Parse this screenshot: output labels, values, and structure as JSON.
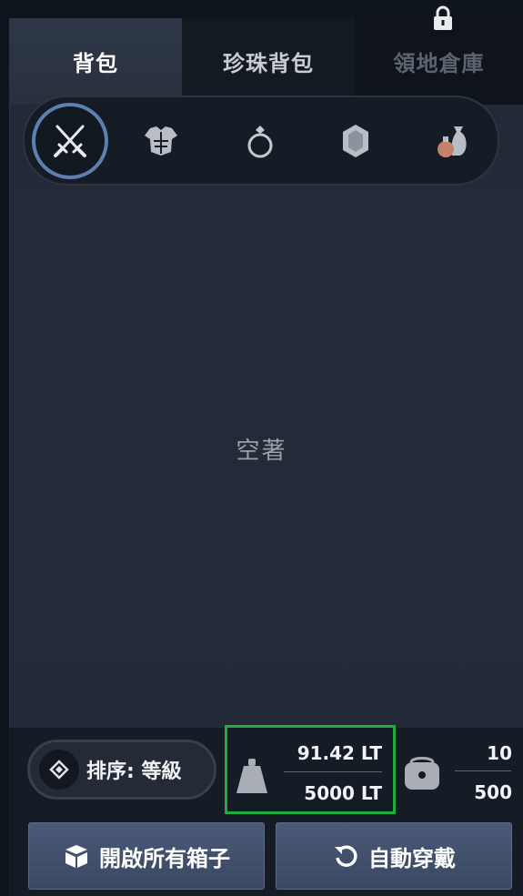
{
  "tabs": [
    {
      "label": "背包",
      "state": "active"
    },
    {
      "label": "珍珠背包",
      "state": "normal"
    },
    {
      "label": "領地倉庫",
      "state": "locked"
    }
  ],
  "categories": [
    {
      "icon": "crossed-swords-icon",
      "selected": true
    },
    {
      "icon": "armor-icon",
      "selected": false
    },
    {
      "icon": "ring-icon",
      "selected": false
    },
    {
      "icon": "gem-icon",
      "selected": false
    },
    {
      "icon": "potion-bag-icon",
      "selected": false
    }
  ],
  "empty_text": "空著",
  "sort": {
    "label": "排序: 等級"
  },
  "weight": {
    "current": "91.42 LT",
    "max": "5000 LT",
    "highlight_color": "#1fae3e"
  },
  "slots": {
    "current": "10",
    "max": "500"
  },
  "buttons": {
    "open_all": "開啟所有箱子",
    "auto_equip": "自動穿戴"
  },
  "colors": {
    "accent_ring": "#5f7fb2",
    "button": "#44526e"
  }
}
